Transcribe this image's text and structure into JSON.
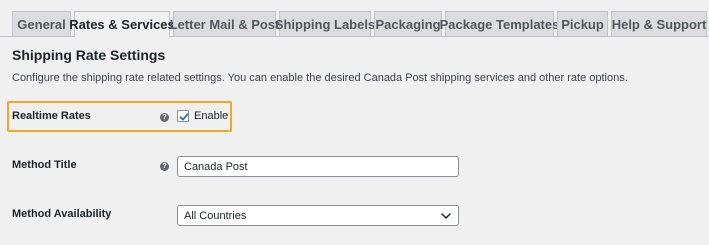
{
  "tabs": [
    {
      "label": "General",
      "active": false
    },
    {
      "label": "Rates & Services",
      "active": true
    },
    {
      "label": "Letter Mail & Post",
      "active": false
    },
    {
      "label": "Shipping Labels",
      "active": false
    },
    {
      "label": "Packaging",
      "active": false
    },
    {
      "label": "Package Templates",
      "active": false
    },
    {
      "label": "Pickup",
      "active": false
    },
    {
      "label": "Help & Support",
      "active": false
    }
  ],
  "section": {
    "title": "Shipping Rate Settings",
    "description": "Configure the shipping rate related settings. You can enable the desired Canada Post shipping services and other rate options."
  },
  "fields": {
    "realtime_rates": {
      "label": "Realtime Rates",
      "help_icon": "question-circle-icon",
      "checkbox_label": "Enable",
      "checked": true
    },
    "method_title": {
      "label": "Method Title",
      "help_icon": "question-circle-icon",
      "value": "Canada Post"
    },
    "method_availability": {
      "label": "Method Availability",
      "selected": "All Countries"
    }
  },
  "colors": {
    "highlight_border": "#f5a623",
    "checkbox_check": "#2271b1",
    "background": "#f0f0f1"
  }
}
